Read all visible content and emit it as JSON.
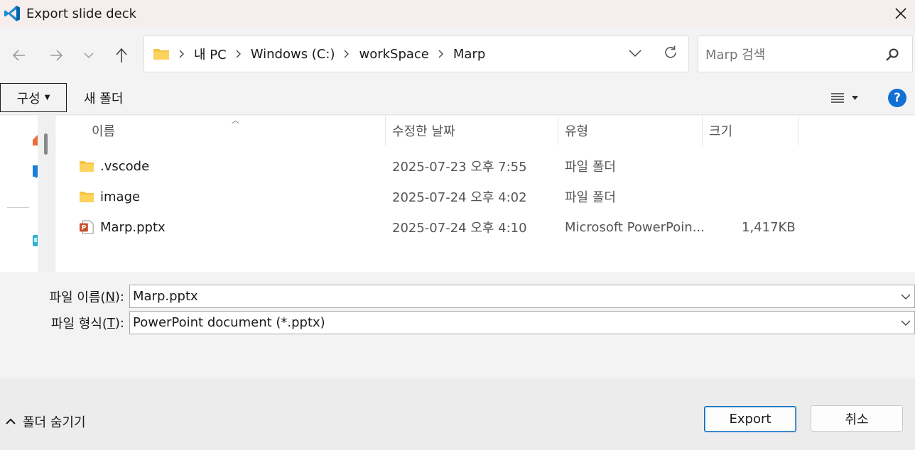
{
  "window": {
    "title": "Export slide deck",
    "accent": "#0078d4"
  },
  "breadcrumb": [
    "내 PC",
    "Windows (C:)",
    "workSpace",
    "Marp"
  ],
  "search": {
    "placeholder": "Marp 검색"
  },
  "toolbar": {
    "organize_label": "구성",
    "new_folder_label": "새 폴더",
    "help_label": "?"
  },
  "columns": {
    "name": "이름",
    "date": "수정한 날짜",
    "type": "유형",
    "size": "크기"
  },
  "files": [
    {
      "name": ".vscode",
      "date": "2025-07-23 오후 7:55",
      "type": "파일 폴더",
      "size": "",
      "icon": "folder-icon"
    },
    {
      "name": "image",
      "date": "2025-07-24 오후 4:02",
      "type": "파일 폴더",
      "size": "",
      "icon": "folder-icon"
    },
    {
      "name": "Marp.pptx",
      "date": "2025-07-24 오후 4:10",
      "type": "Microsoft PowerPoin...",
      "size": "1,417KB",
      "icon": "powerpoint-file-icon"
    }
  ],
  "filename": {
    "label_pre": "파일 이름(",
    "label_key": "N",
    "label_post": "):",
    "value": "Marp.pptx"
  },
  "filetype": {
    "label_pre": "파일 형식(",
    "label_key": "T",
    "label_post": "):",
    "value": "PowerPoint document (*.pptx)"
  },
  "footer": {
    "hide_folders_label": "폴더 숨기기",
    "export_label": "Export",
    "cancel_label": "취소"
  }
}
